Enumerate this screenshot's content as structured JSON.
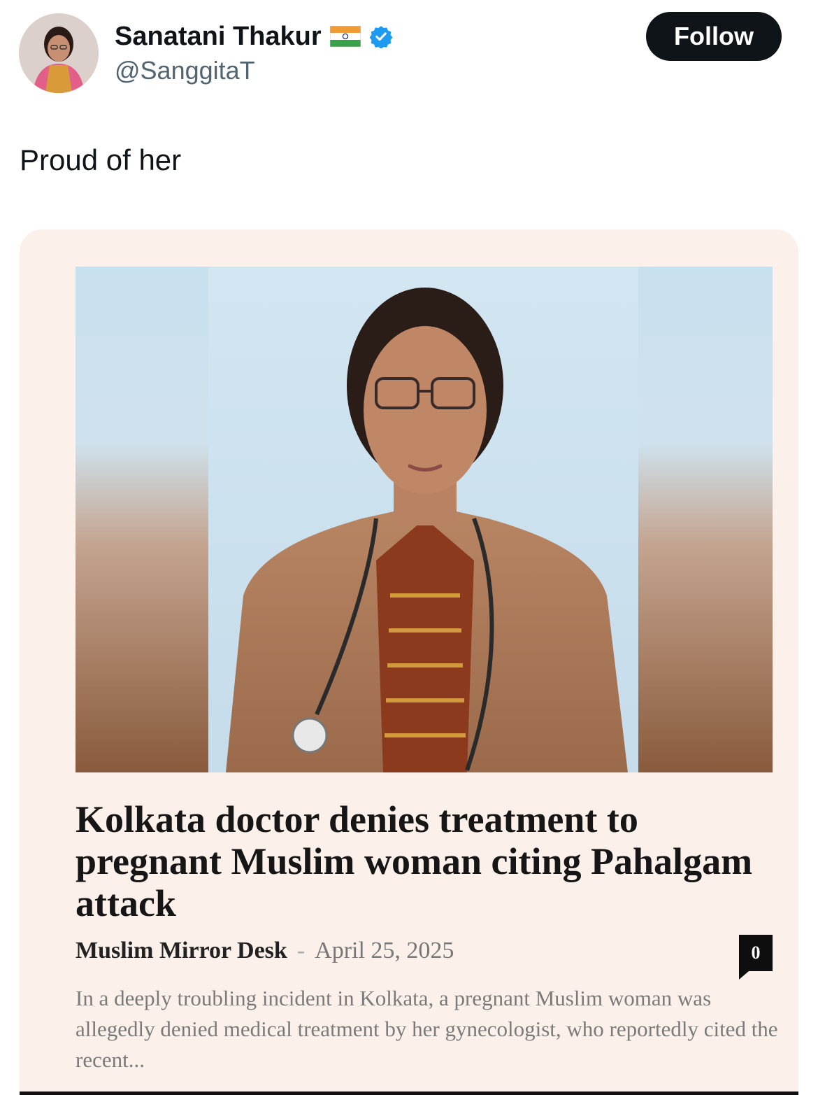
{
  "tweet": {
    "author": {
      "display_name": "Sanatani Thakur",
      "handle": "@SanggitaT",
      "flag_icon": "india-flag-icon",
      "verified_icon": "verified-badge-icon",
      "verified_color": "#1d9bf0"
    },
    "follow_label": "Follow",
    "text": "Proud of her"
  },
  "article_card": {
    "headline": "Kolkata doctor denies treatment to pregnant Muslim woman citing Pahalgam attack",
    "author": "Muslim Mirror Desk",
    "separator": "-",
    "date": "April 25, 2025",
    "comment_count": "0",
    "excerpt": "In a deeply troubling incident in Kolkata, a pregnant Muslim woman was allegedly denied medical treatment by her gynecologist, who reportedly cited the recent..."
  },
  "colors": {
    "card_background": "#fcf0ea",
    "follow_button": "#0f1419",
    "handle_gray": "#536471"
  }
}
